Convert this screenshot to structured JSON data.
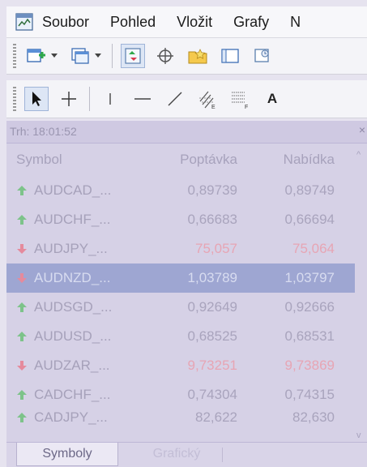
{
  "menu": {
    "items": [
      "Soubor",
      "Pohled",
      "Vložit",
      "Grafy",
      "N"
    ]
  },
  "toolbar2": {
    "text_tool_label": "A"
  },
  "market_watch": {
    "title": "Trh: 18:01:52",
    "close": "×",
    "columns": {
      "symbol": "Symbol",
      "bid": "Poptávka",
      "ask": "Nabídka"
    },
    "rows": [
      {
        "symbol": "AUDCAD_...",
        "bid": "0,89739",
        "ask": "0,89749",
        "direction": "up"
      },
      {
        "symbol": "AUDCHF_...",
        "bid": "0,66683",
        "ask": "0,66694",
        "direction": "up"
      },
      {
        "symbol": "AUDJPY_...",
        "bid": "75,057",
        "ask": "75,064",
        "direction": "down"
      },
      {
        "symbol": "AUDNZD_...",
        "bid": "1,03789",
        "ask": "1,03797",
        "direction": "down",
        "selected": true
      },
      {
        "symbol": "AUDSGD_...",
        "bid": "0,92649",
        "ask": "0,92666",
        "direction": "up"
      },
      {
        "symbol": "AUDUSD_...",
        "bid": "0,68525",
        "ask": "0,68531",
        "direction": "up"
      },
      {
        "symbol": "AUDZAR_...",
        "bid": "9,73251",
        "ask": "9,73869",
        "direction": "down"
      },
      {
        "symbol": "CADCHF_...",
        "bid": "0,74304",
        "ask": "0,74315",
        "direction": "up"
      }
    ],
    "partial_row": {
      "symbol": "CADJPY_...",
      "bid": "82,622",
      "ask": "82,630"
    },
    "tabs": {
      "symbols": "Symboly",
      "ticks": "Grafický"
    },
    "colors": {
      "up": "#7dc38a",
      "down": "#e58a9c",
      "selected_bg": "#9ea6d2"
    }
  }
}
